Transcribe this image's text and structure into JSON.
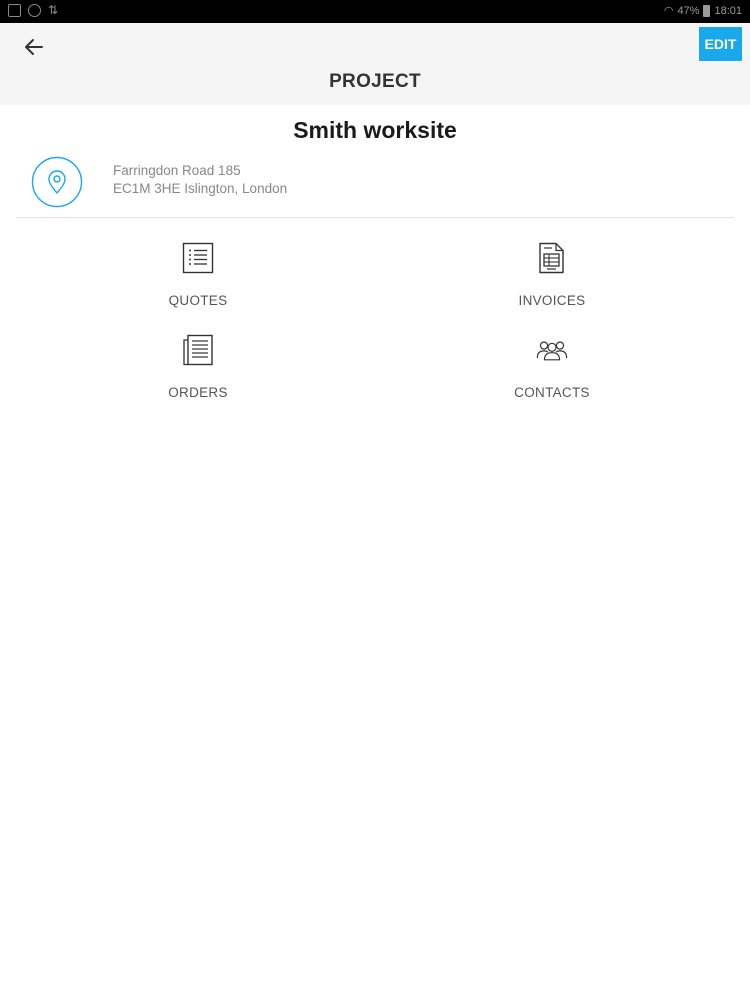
{
  "status_bar": {
    "left_icons": [
      "image-icon",
      "timer-icon",
      "sync-icon"
    ],
    "right_text": "47%",
    "time": "18:01"
  },
  "header": {
    "title": "PROJECT",
    "edit_label": "EDIT",
    "back_icon": "arrow-left-icon"
  },
  "project": {
    "name": "Smith worksite",
    "address_line1": "Farringdon Road 185",
    "address_line2": "EC1M 3HE Islington, London",
    "location_icon": "map-pin-icon"
  },
  "menu": {
    "items": [
      {
        "label": "QUOTES",
        "icon": "list-icon"
      },
      {
        "label": "INVOICES",
        "icon": "invoice-icon"
      },
      {
        "label": "ORDERS",
        "icon": "document-icon"
      },
      {
        "label": "CONTACTS",
        "icon": "people-icon"
      }
    ]
  },
  "colors": {
    "accent": "#1aa7ec",
    "header_bg": "#f5f5f5",
    "text_dark": "#1a1a1a",
    "text_muted": "#888888"
  }
}
